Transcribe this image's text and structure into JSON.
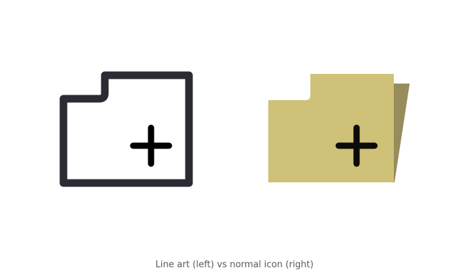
{
  "caption": "Line art (left) vs normal icon (right)",
  "icons": {
    "left": {
      "name": "line-art-folder-add-icon",
      "style": "line-art"
    },
    "right": {
      "name": "folder-add-icon",
      "style": "normal"
    }
  },
  "colors": {
    "line_art_stroke": "#2a2b33",
    "folder_front": "#cfc177",
    "folder_back": "#978c5b",
    "plus": "#0b0b0b",
    "caption_text": "#555a5e",
    "background": "#ffffff"
  }
}
